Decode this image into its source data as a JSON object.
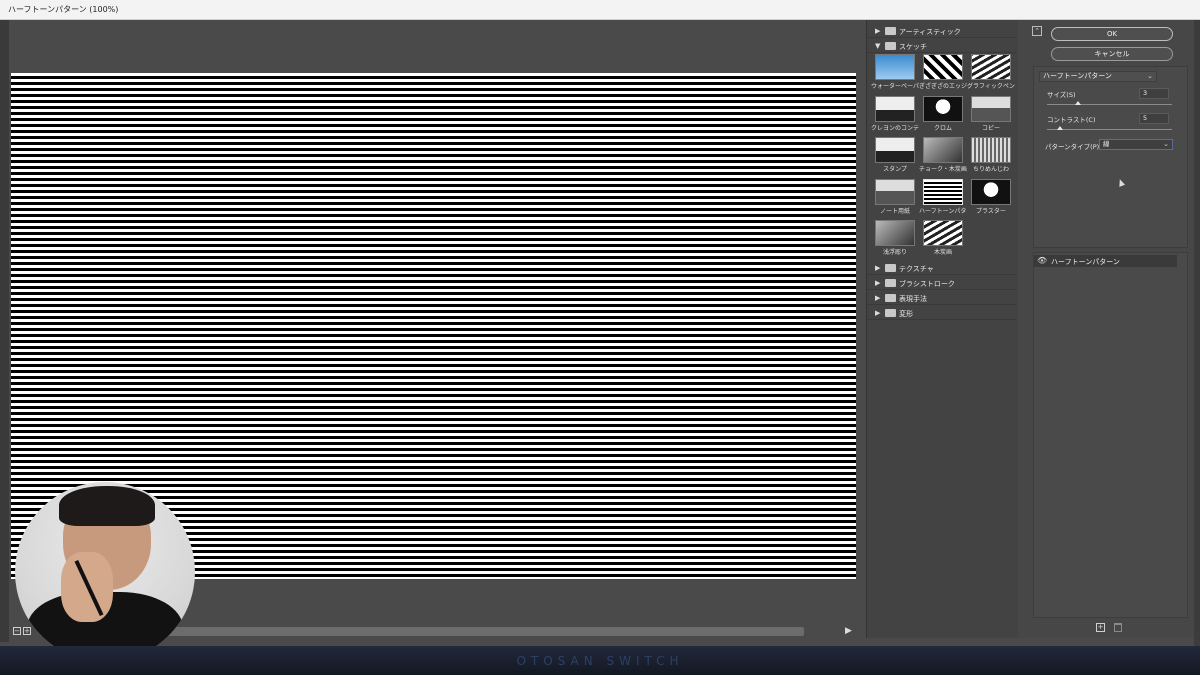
{
  "window": {
    "title": "ハーフトーンパターン (100%)"
  },
  "preview": {
    "zoom_buttons": [
      "−",
      "+"
    ],
    "scroll_arrow": "▶"
  },
  "categories": [
    {
      "label": "アーティスティック",
      "expanded": false
    },
    {
      "label": "スケッチ",
      "expanded": true
    },
    {
      "label": "テクスチャ",
      "expanded": false
    },
    {
      "label": "ブラシストローク",
      "expanded": false
    },
    {
      "label": "表現手法",
      "expanded": false
    },
    {
      "label": "変形",
      "expanded": false
    }
  ],
  "sketch_filters": [
    "ウォーターペーパー",
    "ぎざぎざのエッジ",
    "グラフィックペン",
    "クレヨンのコンテ画",
    "クロム",
    "コピー",
    "スタンプ",
    "チョーク・木炭画",
    "ちりめんじわ",
    "ノート用紙",
    "ハーフトーンパターン",
    "プラスター",
    "浅浮彫り",
    "木炭画"
  ],
  "buttons": {
    "ok": "OK",
    "cancel": "キャンセル"
  },
  "settings": {
    "filter_name": "ハーフトーンパターン",
    "size_label": "サイズ(S)",
    "size_value": "3",
    "size_max": 12,
    "contrast_label": "コントラスト(C)",
    "contrast_value": "5",
    "contrast_max": 50,
    "pattern_label": "パターンタイプ(P) :",
    "pattern_value": "線"
  },
  "layers": [
    {
      "label": "ハーフトーンパターン",
      "visible": true
    }
  ],
  "footer": {
    "brand": "OTOSAN SWITCH"
  },
  "colors": {
    "panel": "#434343",
    "preview_bg": "#4a4a4a",
    "banner": "#141824"
  }
}
